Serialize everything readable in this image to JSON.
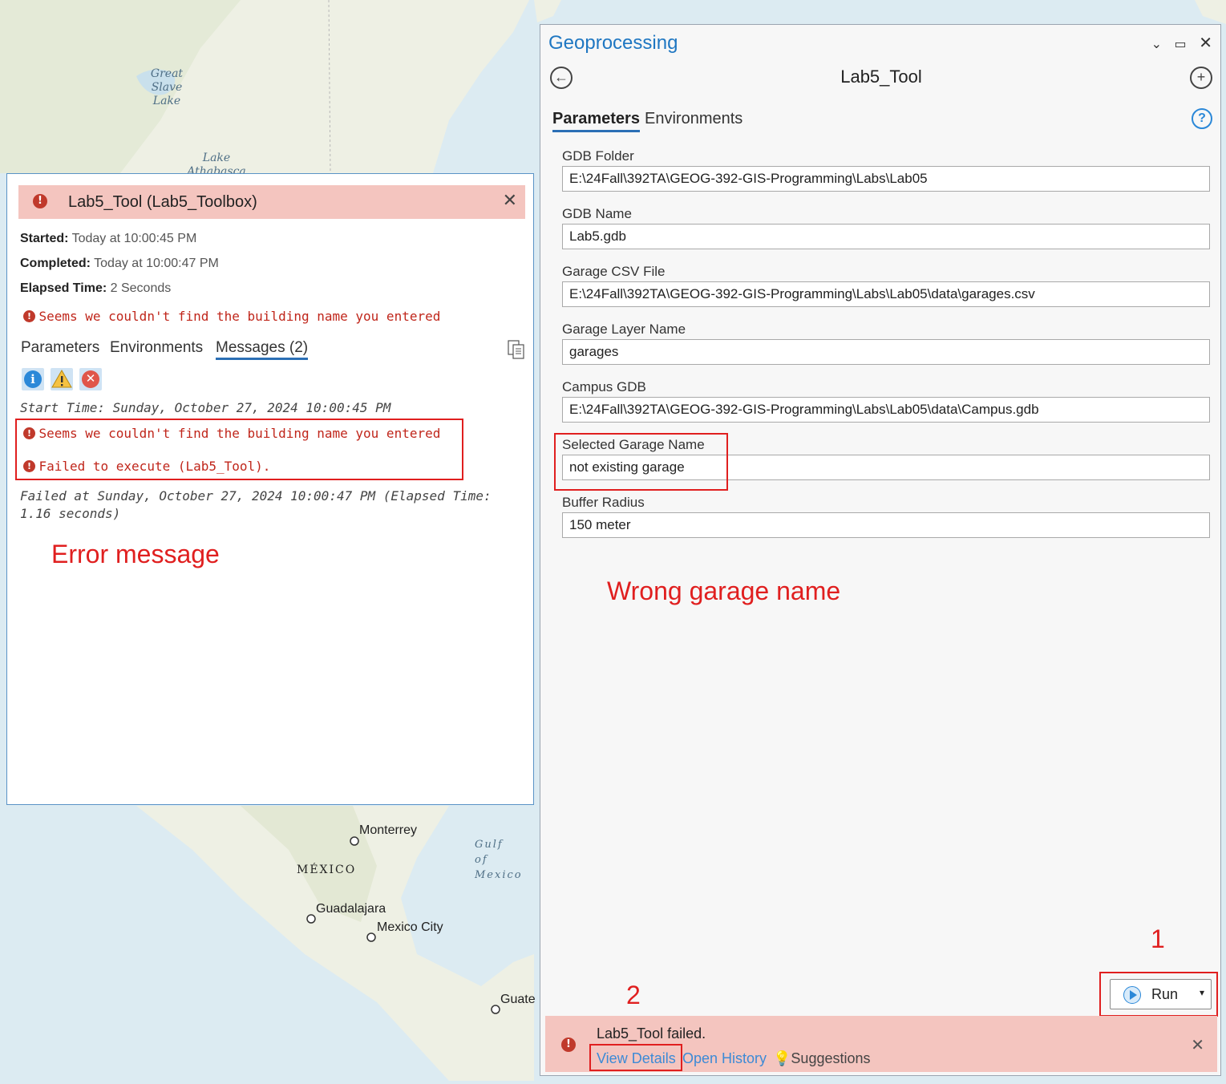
{
  "map": {
    "labels": {
      "great_slave_lake": "Great Slave Lake",
      "lake_athabasca": "Lake Athabasca",
      "monterrey": "Monterrey",
      "mexico": "MÉXICO",
      "guadalajara": "Guadalajara",
      "mexico_city": "Mexico City",
      "gulf_of_mexico": "Gulf of Mexico",
      "guatemala_partial": "Guate"
    }
  },
  "details": {
    "title": "Lab5_Tool (Lab5_Toolbox)",
    "started_label": "Started:",
    "started_value": "Today at 10:00:45 PM",
    "completed_label": "Completed:",
    "completed_value": "Today at 10:00:47 PM",
    "elapsed_label": "Elapsed Time:",
    "elapsed_value": "2 Seconds",
    "error_summary": "Seems we couldn't find the building name you entered",
    "tabs": [
      "Parameters",
      "Environments",
      "Messages (2)"
    ],
    "start_time_line": "Start Time: Sunday, October 27, 2024 10:00:45 PM",
    "messages": [
      "Seems we couldn't find the building name you entered",
      "Failed to execute (Lab5_Tool)."
    ],
    "failed_line_1": "Failed at Sunday, October 27, 2024 10:00:47 PM (Elapsed Time:",
    "failed_line_2": "1.16 seconds)"
  },
  "annotations": {
    "error_message": "Error message",
    "wrong_garage_name": "Wrong garage name",
    "step_1": "1",
    "step_2": "2"
  },
  "geoprocessing": {
    "pane_title": "Geoprocessing",
    "tool_name": "Lab5_Tool",
    "tabs": [
      "Parameters",
      "Environments"
    ],
    "parameters": [
      {
        "label": "GDB Folder",
        "value": "E:\\24Fall\\392TA\\GEOG-392-GIS-Programming\\Labs\\Lab05"
      },
      {
        "label": "GDB Name",
        "value": "Lab5.gdb"
      },
      {
        "label": "Garage CSV File",
        "value": "E:\\24Fall\\392TA\\GEOG-392-GIS-Programming\\Labs\\Lab05\\data\\garages.csv"
      },
      {
        "label": "Garage Layer Name",
        "value": "garages"
      },
      {
        "label": "Campus GDB",
        "value": "E:\\24Fall\\392TA\\GEOG-392-GIS-Programming\\Labs\\Lab05\\data\\Campus.gdb"
      },
      {
        "label": "Selected Garage Name",
        "value": "not existing garage"
      },
      {
        "label": "Buffer Radius",
        "value": "150 meter"
      }
    ],
    "run_label": "Run",
    "fail_message": "Lab5_Tool failed.",
    "view_details": "View Details",
    "open_history": "Open History",
    "suggestions": "Suggestions"
  },
  "colors": {
    "error_bg": "#f4c5bf",
    "accent_blue": "#1f77c2",
    "annotation_red": "#e01f1f",
    "error_text": "#c0261b"
  }
}
